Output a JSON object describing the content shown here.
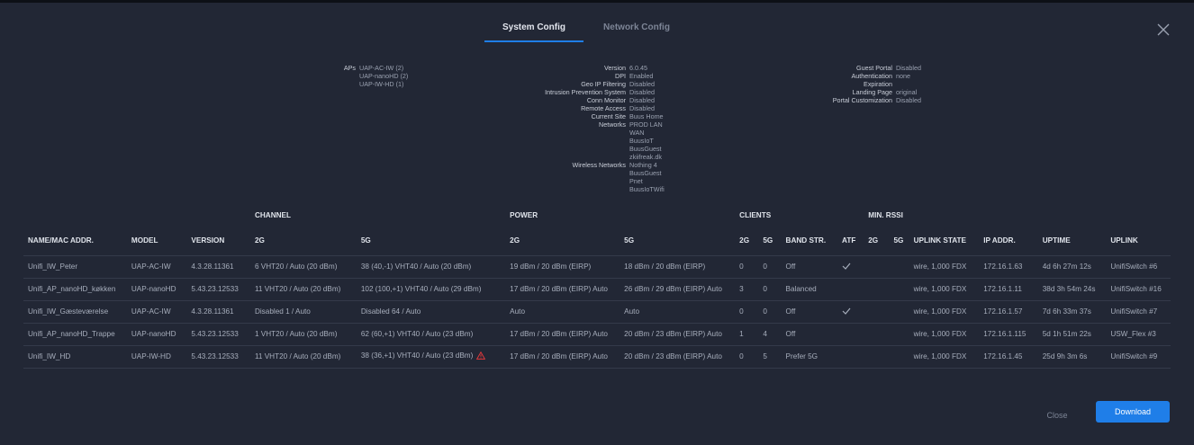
{
  "tabs": [
    "System Config",
    "Network Config"
  ],
  "summary": {
    "col1": [
      {
        "k": "APs",
        "v": "UAP-AC-IW (2)"
      },
      {
        "k": "",
        "v": "UAP-nanoHD (2)"
      },
      {
        "k": "",
        "v": "UAP-IW-HD (1)"
      }
    ],
    "col2": [
      {
        "k": "Version",
        "v": "6.0.45"
      },
      {
        "k": "DPI",
        "v": "Enabled"
      },
      {
        "k": "Geo IP Filtering",
        "v": "Disabled"
      },
      {
        "k": "Intrusion Prevention System",
        "v": "Disabled"
      },
      {
        "k": "Conn Monitor",
        "v": "Disabled"
      },
      {
        "k": "Remote Access",
        "v": "Disabled"
      },
      {
        "k": "Current Site",
        "v": "Buus Home"
      },
      {
        "k": "Networks",
        "v": "PROD LAN"
      },
      {
        "k": "",
        "v": "WAN"
      },
      {
        "k": "",
        "v": "BuusIoT"
      },
      {
        "k": "",
        "v": "BuusGuest"
      },
      {
        "k": "",
        "v": "zkiifreak.dk"
      },
      {
        "k": "Wireless Networks",
        "v": "Nothing 4"
      },
      {
        "k": "",
        "v": "BuusGuest"
      },
      {
        "k": "",
        "v": "Pnet"
      },
      {
        "k": "",
        "v": "BuusIoTWifi"
      }
    ],
    "col3": [
      {
        "k": "Guest Portal",
        "v": "Disabled"
      },
      {
        "k": "Authentication",
        "v": "none"
      },
      {
        "k": "Expiration",
        "v": ""
      },
      {
        "k": "Landing Page",
        "v": "original"
      },
      {
        "k": "Portal Customization",
        "v": "Disabled"
      }
    ]
  },
  "table": {
    "group_headers": {
      "channel": "CHANNEL",
      "power": "POWER",
      "clients": "CLIENTS",
      "min_rssi": "MIN. RSSI"
    },
    "headers": [
      "NAME/MAC ADDR.",
      "MODEL",
      "VERSION",
      "2G",
      "5G",
      "2G",
      "5G",
      "2G",
      "5G",
      "BAND STR.",
      "ATF",
      "2G",
      "5G",
      "UPLINK STATE",
      "IP ADDR.",
      "UPTIME",
      "UPLINK"
    ],
    "rows": [
      {
        "name": "Unifi_IW_Peter",
        "model": "UAP-AC-IW",
        "version": "4.3.28.11361",
        "ch2g": "6 VHT20  / Auto (20 dBm)",
        "ch5g": "38 (40,-1) VHT40  / Auto (20 dBm)",
        "warn": false,
        "pw2g": "19 dBm / 20 dBm (EIRP)",
        "pw5g": "18 dBm / 20 dBm (EIRP)",
        "cl2g": "0",
        "cl5g": "0",
        "band": "Off",
        "atf": true,
        "rs2g": "",
        "rs5g": "",
        "uplink_state": "wire, 1,000 FDX",
        "ip": "172.16.1.63",
        "uptime": "4d 6h 27m 12s",
        "uplink": "UnifiSwitch #6"
      },
      {
        "name": "Unifi_AP_nanoHD_køkken",
        "model": "UAP-nanoHD",
        "version": "5.43.23.12533",
        "ch2g": "11 VHT20  / Auto (20 dBm)",
        "ch5g": "102 (100,+1) VHT40  / Auto (29 dBm)",
        "warn": false,
        "pw2g": "17 dBm / 20 dBm (EIRP) Auto",
        "pw5g": "26 dBm / 29 dBm (EIRP) Auto",
        "cl2g": "3",
        "cl5g": "0",
        "band": "Balanced",
        "atf": false,
        "rs2g": "",
        "rs5g": "",
        "uplink_state": "wire, 1,000 FDX",
        "ip": "172.16.1.11",
        "uptime": "38d 3h 54m 24s",
        "uplink": "UnifiSwitch #16"
      },
      {
        "name": "Unifi_IW_Gæsteværelse",
        "model": "UAP-AC-IW",
        "version": "4.3.28.11361",
        "ch2g": "Disabled 1  / Auto",
        "ch5g": "Disabled 64  / Auto",
        "warn": false,
        "pw2g": "Auto",
        "pw5g": "Auto",
        "cl2g": "0",
        "cl5g": "0",
        "band": "Off",
        "atf": true,
        "rs2g": "",
        "rs5g": "",
        "uplink_state": "wire, 1,000 FDX",
        "ip": "172.16.1.57",
        "uptime": "7d 6h 33m 37s",
        "uplink": "UnifiSwitch #7"
      },
      {
        "name": "Unifi_AP_nanoHD_Trappe",
        "model": "UAP-nanoHD",
        "version": "5.43.23.12533",
        "ch2g": "1 VHT20  / Auto (20 dBm)",
        "ch5g": "62 (60,+1) VHT40  / Auto (23 dBm)",
        "warn": false,
        "pw2g": "17 dBm / 20 dBm (EIRP) Auto",
        "pw5g": "20 dBm / 23 dBm (EIRP) Auto",
        "cl2g": "1",
        "cl5g": "4",
        "band": "Off",
        "atf": false,
        "rs2g": "",
        "rs5g": "",
        "uplink_state": "wire, 1,000 FDX",
        "ip": "172.16.1.115",
        "uptime": "5d 1h 51m 22s",
        "uplink": "USW_Flex #3"
      },
      {
        "name": "Unifi_IW_HD",
        "model": "UAP-IW-HD",
        "version": "5.43.23.12533",
        "ch2g": "11 VHT20  / Auto (20 dBm)",
        "ch5g": "38 (36,+1) VHT40  / Auto (23 dBm)",
        "warn": true,
        "pw2g": "17 dBm / 20 dBm (EIRP) Auto",
        "pw5g": "20 dBm / 23 dBm (EIRP) Auto",
        "cl2g": "0",
        "cl5g": "5",
        "band": "Prefer 5G",
        "atf": false,
        "rs2g": "",
        "rs5g": "",
        "uplink_state": "wire, 1,000 FDX",
        "ip": "172.16.1.45",
        "uptime": "25d 9h 3m 6s",
        "uplink": "UnifiSwitch #9"
      }
    ]
  },
  "footer": {
    "close": "Close",
    "download": "Download"
  },
  "colors": {
    "accent": "#1f7ee8",
    "background": "#222735",
    "warning": "#e0393b"
  }
}
